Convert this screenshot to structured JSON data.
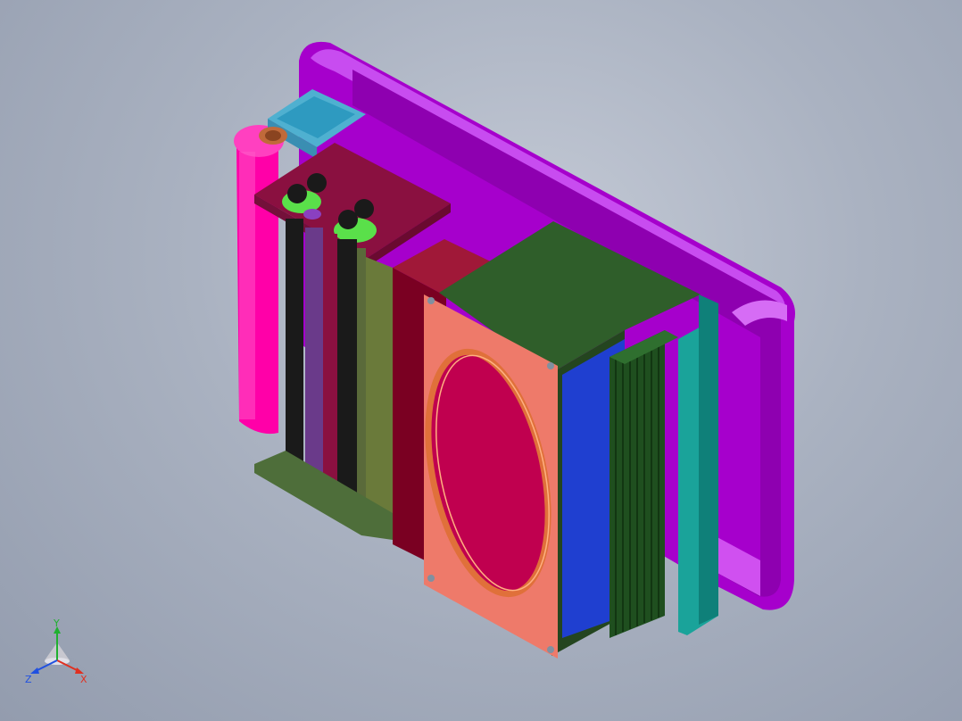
{
  "viewport": {
    "background_top": "#c4cad6",
    "background_bottom": "#939cae"
  },
  "model": {
    "parts": [
      {
        "name": "outer-frame",
        "color": "#b000d8"
      },
      {
        "name": "pink-roller",
        "color": "#ff00a8"
      },
      {
        "name": "top-plate",
        "color": "#8a1040"
      },
      {
        "name": "green-housing",
        "color": "#2f5e2a"
      },
      {
        "name": "salmon-front-panel",
        "color": "#ee7a6a"
      },
      {
        "name": "copper-coil",
        "color": "#e0703a"
      },
      {
        "name": "blue-interior",
        "color": "#1f3fd0"
      },
      {
        "name": "heatsink",
        "color": "#1f4f1f"
      },
      {
        "name": "teal-side-plate",
        "color": "#1aa39a"
      }
    ]
  },
  "triad": {
    "x_label": "X",
    "y_label": "Y",
    "z_label": "Z",
    "x_color": "#e03020",
    "y_color": "#20b030",
    "z_color": "#2050e0"
  }
}
